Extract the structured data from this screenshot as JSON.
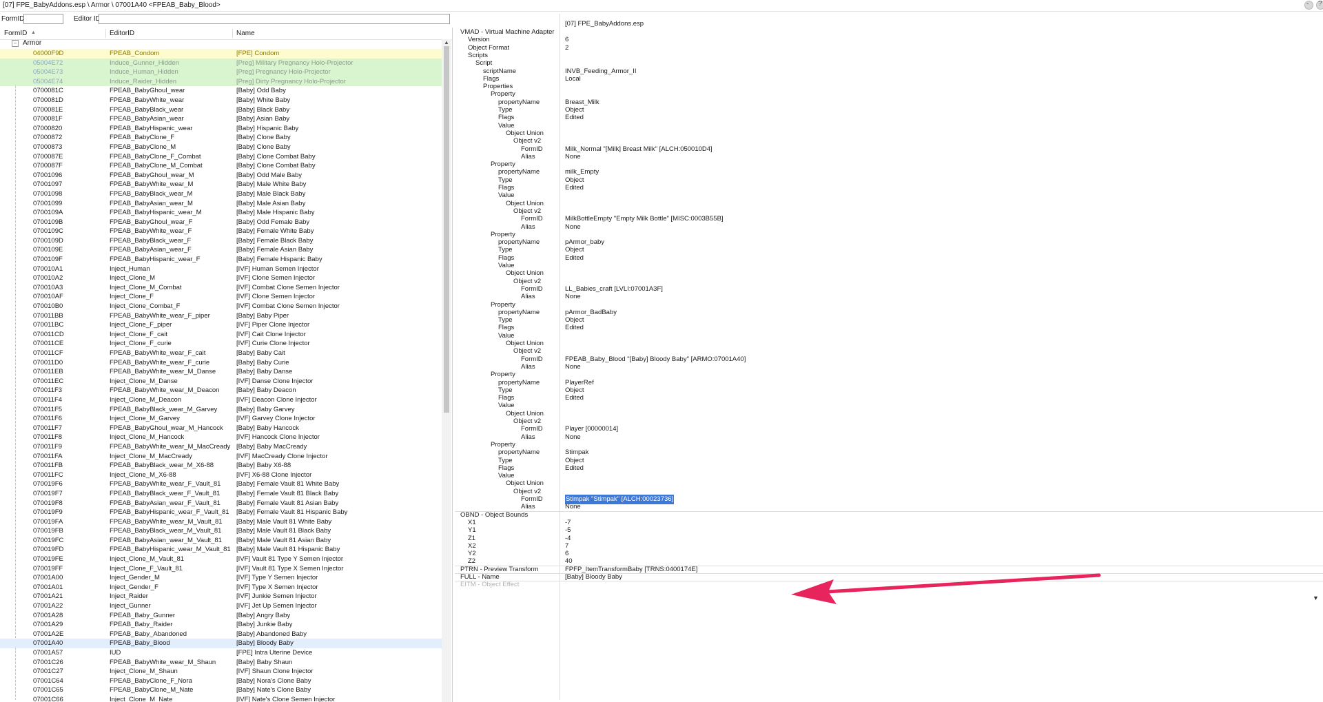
{
  "title": "[07] FPE_BabyAddons.esp \\ Armor \\ 07001A40 <FPEAB_Baby_Blood>",
  "filter": {
    "formid_label": "FormID",
    "editorid_label": "Editor ID"
  },
  "columns": {
    "formid": "FormID",
    "editorid": "EditorID",
    "name": "Name"
  },
  "tree_root": "Armor",
  "records": [
    {
      "fid": "04000F9D",
      "eid": "FPEAB_Condom",
      "nm": "[FPE] Condom",
      "hl": "yellow"
    },
    {
      "fid": "05004E72",
      "eid": "Induce_Gunner_Hidden",
      "nm": "[Preg] Military Pregnancy Holo-Projector",
      "hl": "green"
    },
    {
      "fid": "05004E73",
      "eid": "Induce_Human_Hidden",
      "nm": "[Preg] Pregnancy Holo-Projector",
      "hl": "green"
    },
    {
      "fid": "05004E74",
      "eid": "Induce_Raider_Hidden",
      "nm": "[Preg] Dirty Pregnancy Holo-Projector",
      "hl": "green"
    },
    {
      "fid": "0700081C",
      "eid": "FPEAB_BabyGhoul_wear",
      "nm": "[Baby] Odd Baby",
      "hl": ""
    },
    {
      "fid": "0700081D",
      "eid": "FPEAB_BabyWhite_wear",
      "nm": "[Baby] White Baby",
      "hl": ""
    },
    {
      "fid": "0700081E",
      "eid": "FPEAB_BabyBlack_wear",
      "nm": "[Baby] Black Baby",
      "hl": ""
    },
    {
      "fid": "0700081F",
      "eid": "FPEAB_BabyAsian_wear",
      "nm": "[Baby] Asian Baby",
      "hl": ""
    },
    {
      "fid": "07000820",
      "eid": "FPEAB_BabyHispanic_wear",
      "nm": "[Baby] Hispanic Baby",
      "hl": ""
    },
    {
      "fid": "07000872",
      "eid": "FPEAB_BabyClone_F",
      "nm": "[Baby] Clone Baby",
      "hl": ""
    },
    {
      "fid": "07000873",
      "eid": "FPEAB_BabyClone_M",
      "nm": "[Baby] Clone Baby",
      "hl": ""
    },
    {
      "fid": "0700087E",
      "eid": "FPEAB_BabyClone_F_Combat",
      "nm": "[Baby] Clone Combat Baby",
      "hl": ""
    },
    {
      "fid": "0700087F",
      "eid": "FPEAB_BabyClone_M_Combat",
      "nm": "[Baby] Clone Combat Baby",
      "hl": ""
    },
    {
      "fid": "07001096",
      "eid": "FPEAB_BabyGhoul_wear_M",
      "nm": "[Baby] Odd Male Baby",
      "hl": ""
    },
    {
      "fid": "07001097",
      "eid": "FPEAB_BabyWhite_wear_M",
      "nm": "[Baby] Male White Baby",
      "hl": ""
    },
    {
      "fid": "07001098",
      "eid": "FPEAB_BabyBlack_wear_M",
      "nm": "[Baby] Male Black Baby",
      "hl": ""
    },
    {
      "fid": "07001099",
      "eid": "FPEAB_BabyAsian_wear_M",
      "nm": "[Baby] Male Asian Baby",
      "hl": ""
    },
    {
      "fid": "0700109A",
      "eid": "FPEAB_BabyHispanic_wear_M",
      "nm": "[Baby] Male Hispanic Baby",
      "hl": ""
    },
    {
      "fid": "0700109B",
      "eid": "FPEAB_BabyGhoul_wear_F",
      "nm": "[Baby] Odd Female Baby",
      "hl": ""
    },
    {
      "fid": "0700109C",
      "eid": "FPEAB_BabyWhite_wear_F",
      "nm": "[Baby] Female White Baby",
      "hl": ""
    },
    {
      "fid": "0700109D",
      "eid": "FPEAB_BabyBlack_wear_F",
      "nm": "[Baby] Female Black Baby",
      "hl": ""
    },
    {
      "fid": "0700109E",
      "eid": "FPEAB_BabyAsian_wear_F",
      "nm": "[Baby] Female Asian Baby",
      "hl": ""
    },
    {
      "fid": "0700109F",
      "eid": "FPEAB_BabyHispanic_wear_F",
      "nm": "[Baby] Female Hispanic Baby",
      "hl": ""
    },
    {
      "fid": "070010A1",
      "eid": "Inject_Human",
      "nm": "[IVF] Human Semen Injector",
      "hl": ""
    },
    {
      "fid": "070010A2",
      "eid": "Inject_Clone_M",
      "nm": "[IVF] Clone Semen Injector",
      "hl": ""
    },
    {
      "fid": "070010A3",
      "eid": "Inject_Clone_M_Combat",
      "nm": "[IVF] Combat Clone Semen Injector",
      "hl": ""
    },
    {
      "fid": "070010AF",
      "eid": "Inject_Clone_F",
      "nm": "[IVF] Clone Semen Injector",
      "hl": ""
    },
    {
      "fid": "070010B0",
      "eid": "Inject_Clone_Combat_F",
      "nm": "[IVF] Combat Clone Semen Injector",
      "hl": ""
    },
    {
      "fid": "070011BB",
      "eid": "FPEAB_BabyWhite_wear_F_piper",
      "nm": "[Baby] Baby Piper",
      "hl": ""
    },
    {
      "fid": "070011BC",
      "eid": "Inject_Clone_F_piper",
      "nm": "[IVF] Piper Clone Injector",
      "hl": ""
    },
    {
      "fid": "070011CD",
      "eid": "Inject_Clone_F_cait",
      "nm": "[IVF] Cait Clone Injector",
      "hl": ""
    },
    {
      "fid": "070011CE",
      "eid": "Inject_Clone_F_curie",
      "nm": "[IVF] Curie Clone Injector",
      "hl": ""
    },
    {
      "fid": "070011CF",
      "eid": "FPEAB_BabyWhite_wear_F_cait",
      "nm": "[Baby] Baby Cait",
      "hl": ""
    },
    {
      "fid": "070011D0",
      "eid": "FPEAB_BabyWhite_wear_F_curie",
      "nm": "[Baby] Baby Curie",
      "hl": ""
    },
    {
      "fid": "070011EB",
      "eid": "FPEAB_BabyWhite_wear_M_Danse",
      "nm": "[Baby] Baby Danse",
      "hl": ""
    },
    {
      "fid": "070011EC",
      "eid": "Inject_Clone_M_Danse",
      "nm": "[IVF] Danse Clone Injector",
      "hl": ""
    },
    {
      "fid": "070011F3",
      "eid": "FPEAB_BabyWhite_wear_M_Deacon",
      "nm": "[Baby] Baby Deacon",
      "hl": ""
    },
    {
      "fid": "070011F4",
      "eid": "Inject_Clone_M_Deacon",
      "nm": "[IVF] Deacon Clone Injector",
      "hl": ""
    },
    {
      "fid": "070011F5",
      "eid": "FPEAB_BabyBlack_wear_M_Garvey",
      "nm": "[Baby] Baby Garvey",
      "hl": ""
    },
    {
      "fid": "070011F6",
      "eid": "Inject_Clone_M_Garvey",
      "nm": "[IVF] Garvey Clone Injector",
      "hl": ""
    },
    {
      "fid": "070011F7",
      "eid": "FPEAB_BabyGhoul_wear_M_Hancock",
      "nm": "[Baby] Baby Hancock",
      "hl": ""
    },
    {
      "fid": "070011F8",
      "eid": "Inject_Clone_M_Hancock",
      "nm": "[IVF] Hancock Clone Injector",
      "hl": ""
    },
    {
      "fid": "070011F9",
      "eid": "FPEAB_BabyWhite_wear_M_MacCready",
      "nm": "[Baby] Baby MacCready",
      "hl": ""
    },
    {
      "fid": "070011FA",
      "eid": "Inject_Clone_M_MacCready",
      "nm": "[IVF] MacCready Clone Injector",
      "hl": ""
    },
    {
      "fid": "070011FB",
      "eid": "FPEAB_BabyBlack_wear_M_X6-88",
      "nm": "[Baby] Baby X6-88",
      "hl": ""
    },
    {
      "fid": "070011FC",
      "eid": "Inject_Clone_M_X6-88",
      "nm": "[IVF] X6-88 Clone Injector",
      "hl": ""
    },
    {
      "fid": "070019F6",
      "eid": "FPEAB_BabyWhite_wear_F_Vault_81",
      "nm": "[Baby] Female Vault 81 White Baby",
      "hl": ""
    },
    {
      "fid": "070019F7",
      "eid": "FPEAB_BabyBlack_wear_F_Vault_81",
      "nm": "[Baby] Female Vault 81 Black Baby",
      "hl": ""
    },
    {
      "fid": "070019F8",
      "eid": "FPEAB_BabyAsian_wear_F_Vault_81",
      "nm": "[Baby] Female Vault 81 Asian Baby",
      "hl": ""
    },
    {
      "fid": "070019F9",
      "eid": "FPEAB_BabyHispanic_wear_F_Vault_81",
      "nm": "[Baby] Female Vault 81 Hispanic Baby",
      "hl": ""
    },
    {
      "fid": "070019FA",
      "eid": "FPEAB_BabyWhite_wear_M_Vault_81",
      "nm": "[Baby] Male Vault 81 White Baby",
      "hl": ""
    },
    {
      "fid": "070019FB",
      "eid": "FPEAB_BabyBlack_wear_M_Vault_81",
      "nm": "[Baby] Male Vault 81 Black Baby",
      "hl": ""
    },
    {
      "fid": "070019FC",
      "eid": "FPEAB_BabyAsian_wear_M_Vault_81",
      "nm": "[Baby] Male Vault 81 Asian Baby",
      "hl": ""
    },
    {
      "fid": "070019FD",
      "eid": "FPEAB_BabyHispanic_wear_M_Vault_81",
      "nm": "[Baby] Male Vault 81 Hispanic Baby",
      "hl": ""
    },
    {
      "fid": "070019FE",
      "eid": "Inject_Clone_M_Vault_81",
      "nm": "[IVF] Vault 81 Type Y Semen Injector",
      "hl": ""
    },
    {
      "fid": "070019FF",
      "eid": "Inject_Clone_F_Vault_81",
      "nm": "[IVF] Vault 81 Type X Semen Injector",
      "hl": ""
    },
    {
      "fid": "07001A00",
      "eid": "Inject_Gender_M",
      "nm": "[IVF] Type Y Semen Injector",
      "hl": ""
    },
    {
      "fid": "07001A01",
      "eid": "Inject_Gender_F",
      "nm": "[IVF] Type X Semen Injector",
      "hl": ""
    },
    {
      "fid": "07001A21",
      "eid": "Inject_Raider",
      "nm": "[IVF] Junkie Semen Injector",
      "hl": ""
    },
    {
      "fid": "07001A22",
      "eid": "Inject_Gunner",
      "nm": "[IVF] Jet Up Semen Injector",
      "hl": ""
    },
    {
      "fid": "07001A28",
      "eid": "FPEAB_Baby_Gunner",
      "nm": "[Baby] Angry Baby",
      "hl": ""
    },
    {
      "fid": "07001A29",
      "eid": "FPEAB_Baby_Raider",
      "nm": "[Baby] Junkie Baby",
      "hl": ""
    },
    {
      "fid": "07001A2E",
      "eid": "FPEAB_Baby_Abandoned",
      "nm": "[Baby] Abandoned Baby",
      "hl": ""
    },
    {
      "fid": "07001A40",
      "eid": "FPEAB_Baby_Blood",
      "nm": "[Baby] Bloody Baby",
      "hl": "sel"
    },
    {
      "fid": "07001A57",
      "eid": "IUD",
      "nm": "[FPE] Intra Uterine Device",
      "hl": ""
    },
    {
      "fid": "07001C26",
      "eid": "FPEAB_BabyWhite_wear_M_Shaun",
      "nm": "[Baby] Baby Shaun",
      "hl": ""
    },
    {
      "fid": "07001C27",
      "eid": "Inject_Clone_M_Shaun",
      "nm": "[IVF] Shaun Clone Injector",
      "hl": ""
    },
    {
      "fid": "07001C64",
      "eid": "FPEAB_BabyClone_F_Nora",
      "nm": "[Baby] Nora's Clone Baby",
      "hl": ""
    },
    {
      "fid": "07001C65",
      "eid": "FPEAB_BabyClone_M_Nate",
      "nm": "[Baby] Nate's Clone Baby",
      "hl": ""
    },
    {
      "fid": "07001C66",
      "eid": "Inject_Clone_M_Nate",
      "nm": "[IVF] Nate's Clone Semen Injector",
      "hl": ""
    }
  ],
  "detail": {
    "header_value": "[07] FPE_BabyAddons.esp",
    "rows": [
      {
        "k": "VMAD - Virtual Machine Adapter",
        "v": "",
        "d": 0
      },
      {
        "k": "Version",
        "v": "6",
        "d": 1
      },
      {
        "k": "Object Format",
        "v": "2",
        "d": 1
      },
      {
        "k": "Scripts",
        "v": "",
        "d": 1
      },
      {
        "k": "Script",
        "v": "",
        "d": 2
      },
      {
        "k": "scriptName",
        "v": "INVB_Feeding_Armor_II",
        "d": 3
      },
      {
        "k": "Flags",
        "v": "Local",
        "d": 3
      },
      {
        "k": "Properties",
        "v": "",
        "d": 3
      },
      {
        "k": "Property",
        "v": "",
        "d": 4
      },
      {
        "k": "propertyName",
        "v": "Breast_Milk",
        "d": 5
      },
      {
        "k": "Type",
        "v": "Object",
        "d": 5
      },
      {
        "k": "Flags",
        "v": "Edited",
        "d": 5
      },
      {
        "k": "Value",
        "v": "",
        "d": 5
      },
      {
        "k": "Object Union",
        "v": "",
        "d": 6
      },
      {
        "k": "Object v2",
        "v": "",
        "d": 7
      },
      {
        "k": "FormID",
        "v": "Milk_Normal \"[Milk] Breast Milk\" [ALCH:050010D4]",
        "d": 8
      },
      {
        "k": "Alias",
        "v": "None",
        "d": 8
      },
      {
        "k": "Property",
        "v": "",
        "d": 4
      },
      {
        "k": "propertyName",
        "v": "milk_Empty",
        "d": 5
      },
      {
        "k": "Type",
        "v": "Object",
        "d": 5
      },
      {
        "k": "Flags",
        "v": "Edited",
        "d": 5
      },
      {
        "k": "Value",
        "v": "",
        "d": 5
      },
      {
        "k": "Object Union",
        "v": "",
        "d": 6
      },
      {
        "k": "Object v2",
        "v": "",
        "d": 7
      },
      {
        "k": "FormID",
        "v": "MilkBottleEmpty \"Empty Milk Bottle\" [MISC:0003B55B]",
        "d": 8
      },
      {
        "k": "Alias",
        "v": "None",
        "d": 8
      },
      {
        "k": "Property",
        "v": "",
        "d": 4
      },
      {
        "k": "propertyName",
        "v": "pArmor_baby",
        "d": 5
      },
      {
        "k": "Type",
        "v": "Object",
        "d": 5
      },
      {
        "k": "Flags",
        "v": "Edited",
        "d": 5
      },
      {
        "k": "Value",
        "v": "",
        "d": 5
      },
      {
        "k": "Object Union",
        "v": "",
        "d": 6
      },
      {
        "k": "Object v2",
        "v": "",
        "d": 7
      },
      {
        "k": "FormID",
        "v": "LL_Babies_craft [LVLI:07001A3F]",
        "d": 8
      },
      {
        "k": "Alias",
        "v": "None",
        "d": 8
      },
      {
        "k": "Property",
        "v": "",
        "d": 4
      },
      {
        "k": "propertyName",
        "v": "pArmor_BadBaby",
        "d": 5
      },
      {
        "k": "Type",
        "v": "Object",
        "d": 5
      },
      {
        "k": "Flags",
        "v": "Edited",
        "d": 5
      },
      {
        "k": "Value",
        "v": "",
        "d": 5
      },
      {
        "k": "Object Union",
        "v": "",
        "d": 6
      },
      {
        "k": "Object v2",
        "v": "",
        "d": 7
      },
      {
        "k": "FormID",
        "v": "FPEAB_Baby_Blood \"[Baby] Bloody Baby\" [ARMO:07001A40]",
        "d": 8
      },
      {
        "k": "Alias",
        "v": "None",
        "d": 8
      },
      {
        "k": "Property",
        "v": "",
        "d": 4
      },
      {
        "k": "propertyName",
        "v": "PlayerRef",
        "d": 5
      },
      {
        "k": "Type",
        "v": "Object",
        "d": 5
      },
      {
        "k": "Flags",
        "v": "Edited",
        "d": 5
      },
      {
        "k": "Value",
        "v": "",
        "d": 5
      },
      {
        "k": "Object Union",
        "v": "",
        "d": 6
      },
      {
        "k": "Object v2",
        "v": "",
        "d": 7
      },
      {
        "k": "FormID",
        "v": "Player [00000014]",
        "d": 8
      },
      {
        "k": "Alias",
        "v": "None",
        "d": 8
      },
      {
        "k": "Property",
        "v": "",
        "d": 4
      },
      {
        "k": "propertyName",
        "v": "Stimpak",
        "d": 5
      },
      {
        "k": "Type",
        "v": "Object",
        "d": 5
      },
      {
        "k": "Flags",
        "v": "Edited",
        "d": 5
      },
      {
        "k": "Value",
        "v": "",
        "d": 5
      },
      {
        "k": "Object Union",
        "v": "",
        "d": 6
      },
      {
        "k": "Object v2",
        "v": "",
        "d": 7
      },
      {
        "k": "FormID",
        "v": "Stimpak \"Stimpak\" [ALCH:00023736]",
        "d": 8,
        "sel": true
      },
      {
        "k": "Alias",
        "v": "None",
        "d": 8
      },
      {
        "k": "OBND - Object Bounds",
        "v": "",
        "d": 0,
        "sepBefore": true
      },
      {
        "k": "X1",
        "v": "-7",
        "d": 1
      },
      {
        "k": "Y1",
        "v": "-5",
        "d": 1
      },
      {
        "k": "Z1",
        "v": "-4",
        "d": 1
      },
      {
        "k": "X2",
        "v": "7",
        "d": 1
      },
      {
        "k": "Y2",
        "v": "6",
        "d": 1
      },
      {
        "k": "Z2",
        "v": "40",
        "d": 1
      },
      {
        "k": "PTRN - Preview Transform",
        "v": "FPFP_ItemTransformBaby [TRNS:0400174E]",
        "d": 0,
        "sepBefore": true
      },
      {
        "k": "FULL - Name",
        "v": "[Baby] Bloody Baby",
        "d": 0,
        "sepBefore": true
      },
      {
        "k": "EITM - Object Effect",
        "v": "",
        "d": 0,
        "sepBefore": true,
        "faded": true
      }
    ]
  },
  "colors": {
    "selection": "#3b78d8",
    "arrow": "#e8245c",
    "highlight_yellow": "#fefccf",
    "highlight_green": "#d9f5cf"
  }
}
